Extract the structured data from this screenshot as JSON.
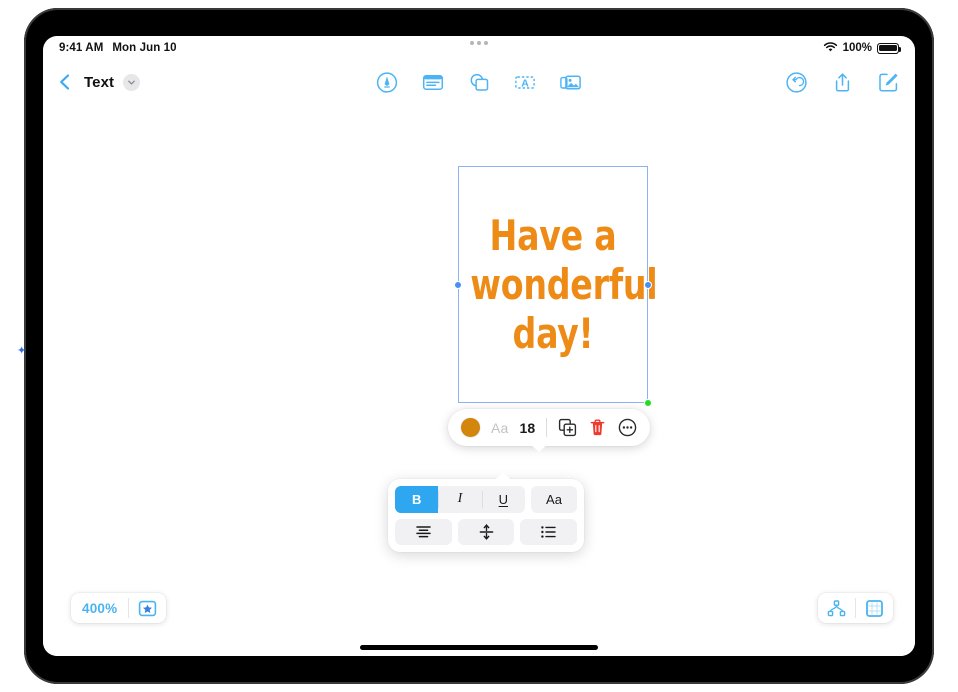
{
  "status_bar": {
    "time": "9:41 AM",
    "date": "Mon Jun 10",
    "wifi_icon": "wifi-icon",
    "battery_percent": "100%",
    "battery_icon": "battery-full-icon"
  },
  "multitask_control": {
    "icon": "multitask-dots-icon"
  },
  "nav_bar": {
    "back_icon": "chevron-left-icon",
    "title": "Text",
    "title_chevron_icon": "chevron-down-icon",
    "center_tools": [
      {
        "name": "markup-pen-tool",
        "icon": "markup-pen-icon"
      },
      {
        "name": "note-tool",
        "icon": "note-icon"
      },
      {
        "name": "shapes-tool",
        "icon": "shapes-icon"
      },
      {
        "name": "text-box-tool",
        "icon": "text-box-icon"
      },
      {
        "name": "media-tool",
        "icon": "photo-stack-icon"
      }
    ],
    "right_tools": [
      {
        "name": "undo-button",
        "icon": "undo-circle-icon"
      },
      {
        "name": "share-button",
        "icon": "share-up-arrow-icon"
      },
      {
        "name": "compose-button",
        "icon": "compose-pencil-square-icon"
      }
    ]
  },
  "canvas": {
    "text_object": {
      "content": "Have a wonderful day!",
      "color": "#ED8B16",
      "selection_border_color": "#8bb2f2",
      "handles": [
        {
          "name": "resize-handle-left",
          "color": "#4a90f0"
        },
        {
          "name": "resize-handle-right",
          "color": "#4a90f0"
        },
        {
          "name": "resize-handle-bottom-right",
          "color": "#22dd22"
        }
      ]
    }
  },
  "format_bar": {
    "color_swatch": "#D4850B",
    "font_label": "Aa",
    "font_size": "18",
    "actions": [
      {
        "name": "duplicate-button",
        "icon": "duplicate-layers-icon"
      },
      {
        "name": "delete-button",
        "icon": "trash-icon",
        "color": "#ee3b30"
      },
      {
        "name": "more-button",
        "icon": "ellipsis-circle-icon"
      }
    ]
  },
  "format_panel": {
    "row1": [
      {
        "name": "bold-button",
        "label": "B",
        "active": true
      },
      {
        "name": "italic-button",
        "label": "I",
        "active": false
      },
      {
        "name": "underline-button",
        "label": "U",
        "active": false
      },
      {
        "name": "font-style-button",
        "label": "Aa",
        "active": false
      }
    ],
    "row2": [
      {
        "name": "align-center-button",
        "icon": "text-align-center-icon"
      },
      {
        "name": "vertical-align-center-button",
        "icon": "vertical-align-center-icon"
      },
      {
        "name": "bulleted-list-button",
        "icon": "bulleted-list-icon"
      }
    ]
  },
  "bottom_bar": {
    "zoom_level": "400%",
    "favorite_icon": "star-square-icon",
    "right_tools": [
      {
        "name": "connection-map-button",
        "icon": "node-hierarchy-icon"
      },
      {
        "name": "frame-button",
        "icon": "grid-frame-icon"
      }
    ]
  },
  "accent_colors": {
    "blue": "#2ea7f0",
    "light_blue": "#4ab3f0",
    "orange_text": "#ED8B16",
    "orange_swatch": "#D4850B",
    "red": "#ee3b30"
  }
}
